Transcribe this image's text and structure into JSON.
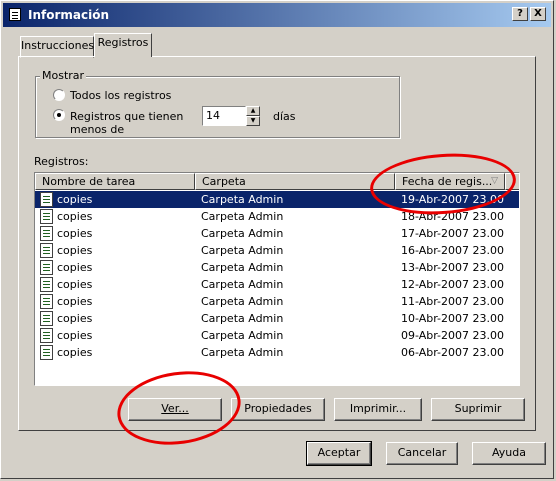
{
  "window": {
    "title": "Información",
    "help_label": "?",
    "close_label": "X"
  },
  "tabs": [
    {
      "label": "Instrucciones"
    },
    {
      "label": "Registros"
    }
  ],
  "show_group": {
    "legend": "Mostrar",
    "option_all": "Todos los registros",
    "option_recent_line1": "Registros que tienen",
    "option_recent_line2": "menos de",
    "days_value": "14",
    "days_unit": "días"
  },
  "records": {
    "label": "Registros:",
    "columns": {
      "task": "Nombre de tarea",
      "folder": "Carpeta",
      "date": "Fecha de regis..."
    },
    "rows": [
      {
        "task": "copies",
        "folder": "Carpeta Admin",
        "date": "19-Abr-2007 23.00"
      },
      {
        "task": "copies",
        "folder": "Carpeta Admin",
        "date": "18-Abr-2007 23.00"
      },
      {
        "task": "copies",
        "folder": "Carpeta Admin",
        "date": "17-Abr-2007 23.00"
      },
      {
        "task": "copies",
        "folder": "Carpeta Admin",
        "date": "16-Abr-2007 23.00"
      },
      {
        "task": "copies",
        "folder": "Carpeta Admin",
        "date": "13-Abr-2007 23.00"
      },
      {
        "task": "copies",
        "folder": "Carpeta Admin",
        "date": "12-Abr-2007 23.00"
      },
      {
        "task": "copies",
        "folder": "Carpeta Admin",
        "date": "11-Abr-2007 23.00"
      },
      {
        "task": "copies",
        "folder": "Carpeta Admin",
        "date": "10-Abr-2007 23.00"
      },
      {
        "task": "copies",
        "folder": "Carpeta Admin",
        "date": "09-Abr-2007 23.00"
      },
      {
        "task": "copies",
        "folder": "Carpeta Admin",
        "date": "06-Abr-2007 23.00"
      }
    ]
  },
  "actions": {
    "view": "Ver...",
    "properties": "Propiedades",
    "print": "Imprimir...",
    "delete": "Suprimir"
  },
  "footer": {
    "ok": "Aceptar",
    "cancel": "Cancelar",
    "help": "Ayuda"
  },
  "colors": {
    "titlebar": "#0a246a",
    "selection": "#0a246a",
    "annotation": "#e80000"
  }
}
